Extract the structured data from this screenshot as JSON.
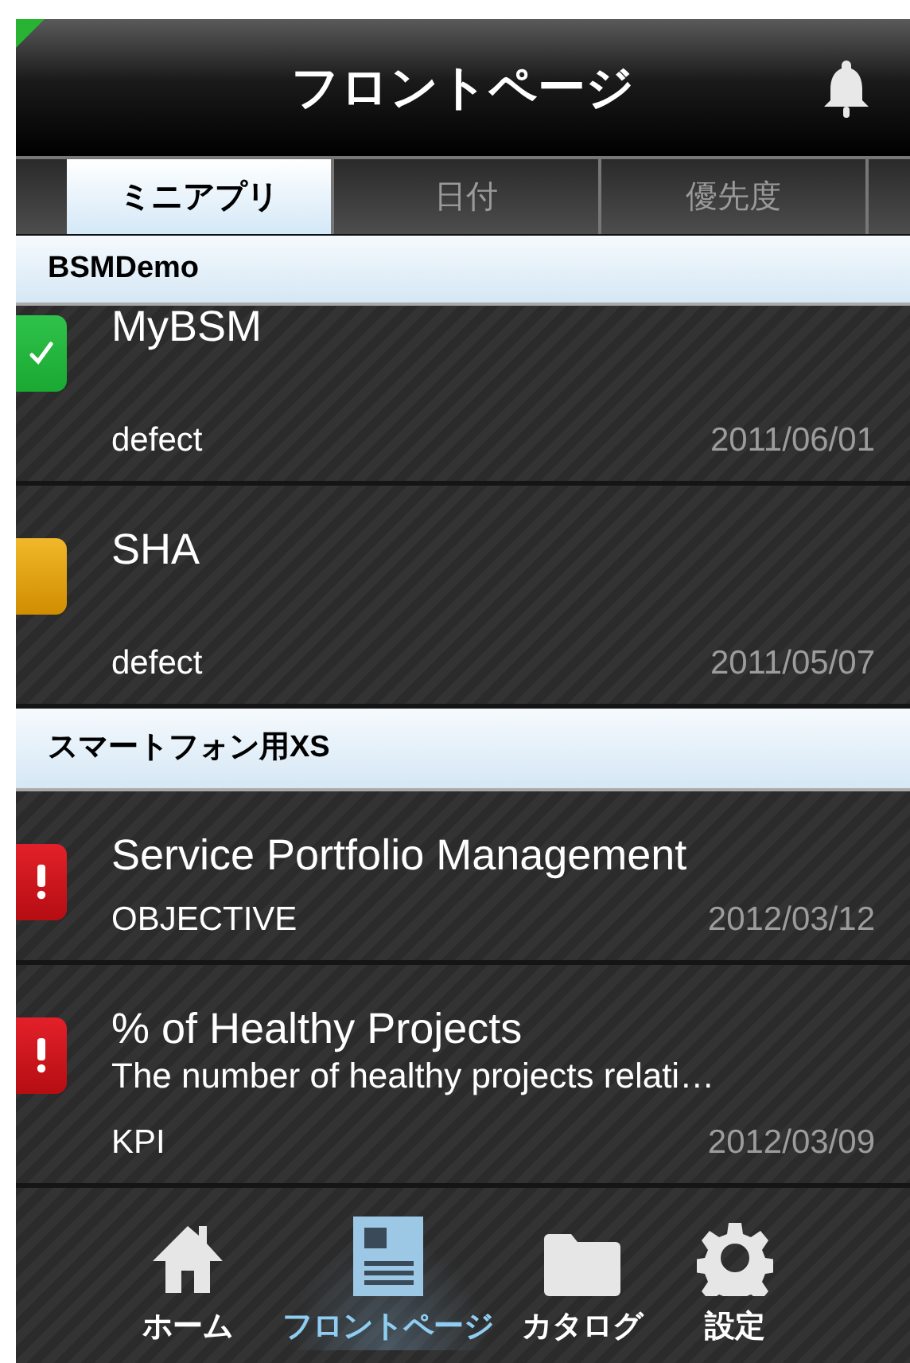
{
  "header": {
    "title": "フロントページ"
  },
  "tabs": [
    {
      "label": "ミニアプリ",
      "selected": true
    },
    {
      "label": "日付",
      "selected": false
    },
    {
      "label": "優先度",
      "selected": false
    }
  ],
  "sections": [
    {
      "title": "BSMDemo",
      "rows": [
        {
          "kind": "done",
          "title": "MyBSM",
          "type": "defect",
          "date": "2011/06/01"
        },
        {
          "kind": "pending",
          "title": "SHA",
          "type": "defect",
          "date": "2011/05/07"
        }
      ]
    },
    {
      "title": "スマートフォン用XS",
      "rows": [
        {
          "kind": "alert",
          "title": "Service Portfolio Management",
          "type": "OBJECTIVE",
          "date": "2012/03/12"
        },
        {
          "kind": "alert",
          "title": "% of Healthy Projects",
          "subtitle": "The number of healthy projects relati…",
          "type": "KPI",
          "date": "2012/03/09"
        }
      ]
    }
  ],
  "bottom_nav": [
    {
      "label": "ホーム",
      "selected": false
    },
    {
      "label": "フロントページ",
      "selected": true
    },
    {
      "label": "カタログ",
      "selected": false
    },
    {
      "label": "設定",
      "selected": false
    }
  ]
}
